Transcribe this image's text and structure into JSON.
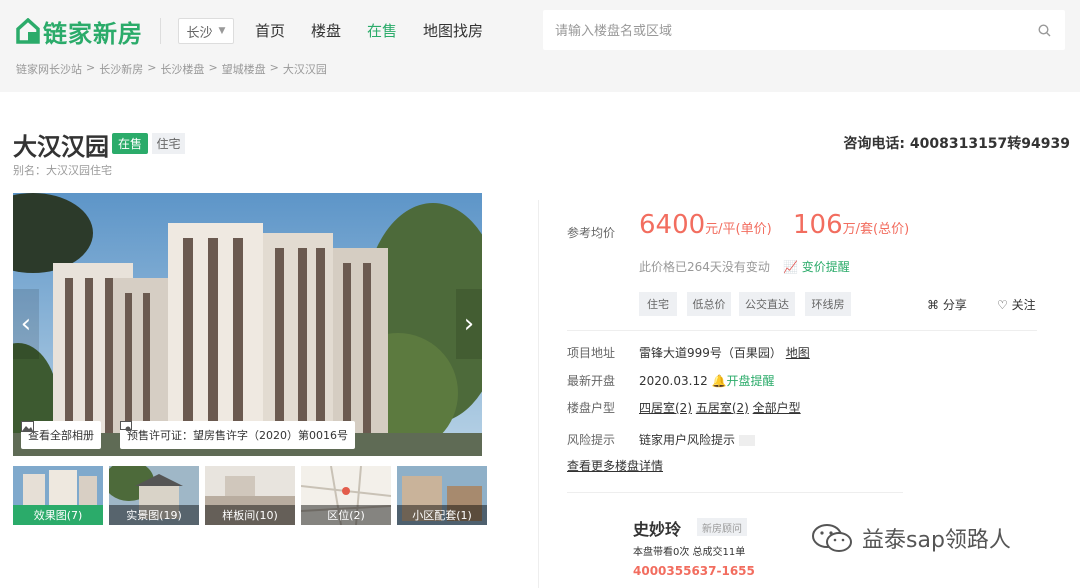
{
  "header": {
    "logo_text": "链家新房",
    "city": "长沙",
    "nav": [
      "首页",
      "楼盘",
      "在售",
      "地图找房"
    ],
    "active_nav": "在售",
    "search_placeholder": "请输入楼盘名或区域"
  },
  "breadcrumb": [
    "链家网长沙站",
    ">",
    "长沙新房",
    ">",
    "长沙楼盘",
    ">",
    "望城楼盘",
    ">",
    "大汉汉园"
  ],
  "property": {
    "title": "大汉汉园",
    "status_tag": "在售",
    "type_tag": "住宅",
    "alias": "别名：大汉汉园住宅",
    "phone": "咨询电话: 4008313157转94939"
  },
  "gallery": {
    "all_photos": "查看全部相册",
    "permit": "预售许可证：望房售许字（2020）第0016号",
    "thumbs": [
      "效果图(7)",
      "实景图(19)",
      "样板间(10)",
      "区位(2)",
      "小区配套(1)"
    ]
  },
  "price": {
    "label": "参考均价",
    "unit_price": "6400",
    "unit_price_suffix": "元/平(单价)",
    "total_price": "106",
    "total_price_suffix": "万/套(总价)",
    "note": "此价格已264天没有变动",
    "change_alert": "变价提醒"
  },
  "features": [
    "住宅",
    "低总价",
    "公交直达",
    "环线房"
  ],
  "actions": {
    "share": "分享",
    "follow": "关注"
  },
  "details": {
    "address_label": "项目地址",
    "address": "雷锋大道999号（百果园）",
    "map_link": "地图",
    "open_label": "最新开盘",
    "open_date": "2020.03.12",
    "open_alert": "开盘提醒",
    "layout_label": "楼盘户型",
    "layout_4": "四居室(2)",
    "layout_5": "五居室(2)",
    "layout_all": "全部户型",
    "risk_label": "风险提示",
    "risk_value": "链家用户风险提示",
    "more_link": "查看更多楼盘详情"
  },
  "agent": {
    "name": "史妙玲",
    "role": "新房顾问",
    "stats": "本盘带看0次 总成交11单",
    "phone": "4000355637-1655"
  },
  "watermark": "益泰sap领路人",
  "colors": {
    "brand_green": "#2bab6a",
    "price_red": "#f26d5f"
  }
}
